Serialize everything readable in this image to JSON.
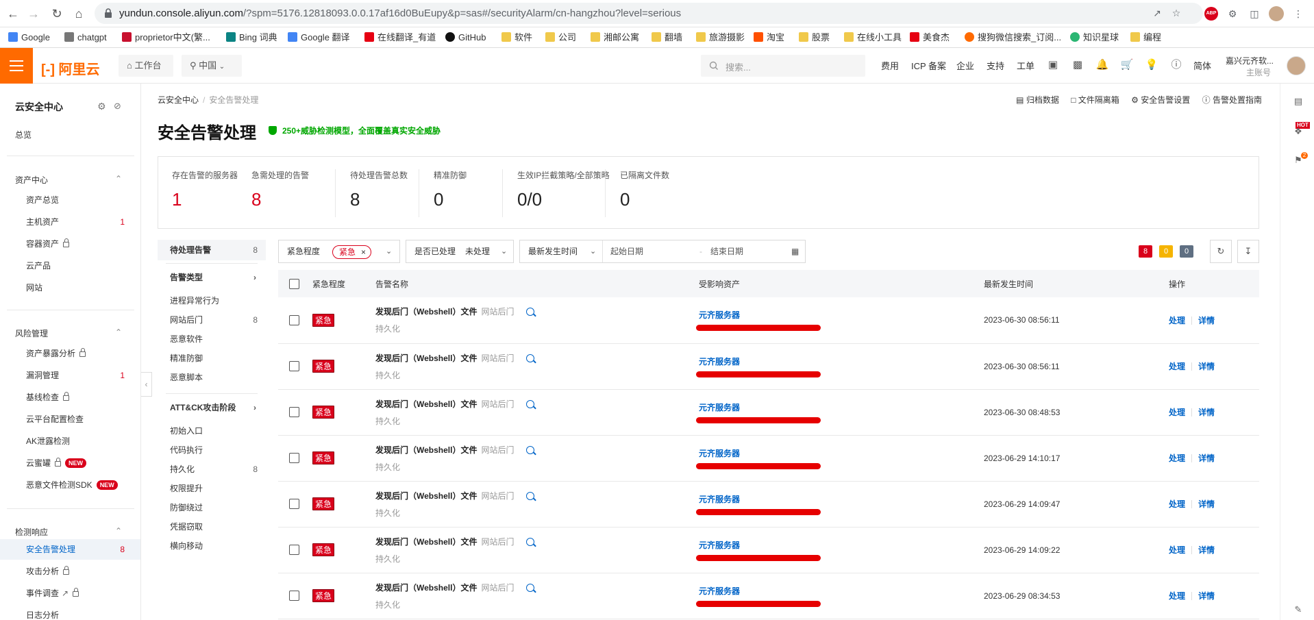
{
  "browser": {
    "url_host": "yundun.console.aliyun.com",
    "url_rest": "/?spm=5176.12818093.0.0.17af16d0BuEupy&p=sas#/securityAlarm/cn-hangzhou?level=serious",
    "bookmarks": [
      "Google",
      "chatgpt",
      "proprietor中文(繁...",
      "Bing 词典",
      "Google 翻译",
      "在线翻译_有道",
      "GitHub",
      "软件",
      "公司",
      "湘邮公寓",
      "翻墙",
      "旅游摄影",
      "淘宝",
      "股票",
      "在线小工具",
      "美食杰",
      "搜狗微信搜索_订阅...",
      "知识星球",
      "编程"
    ],
    "ext_abp": "ABP"
  },
  "header": {
    "logo": "[-] 阿里云",
    "workbench": "工作台",
    "region": "中国",
    "search_placeholder": "搜索...",
    "links": [
      "费用",
      "ICP 备案",
      "企业",
      "支持",
      "工单"
    ],
    "lang": "简体",
    "account_name": "嘉兴元齐软...",
    "account_role": "主账号"
  },
  "sidebar": {
    "title": "云安全中心",
    "overview": "总览",
    "groups": [
      {
        "label": "资产中心",
        "items": [
          {
            "label": "资产总览",
            "count": ""
          },
          {
            "label": "主机资产",
            "count": "1"
          },
          {
            "label": "容器资产",
            "count": "",
            "lock": true
          },
          {
            "label": "云产品",
            "count": ""
          },
          {
            "label": "网站",
            "count": ""
          }
        ]
      },
      {
        "label": "风险管理",
        "items": [
          {
            "label": "资产暴露分析",
            "count": "",
            "lock": true
          },
          {
            "label": "漏洞管理",
            "count": "1"
          },
          {
            "label": "基线检查",
            "count": "",
            "lock": true
          },
          {
            "label": "云平台配置检查",
            "count": ""
          },
          {
            "label": "AK泄露检测",
            "count": ""
          },
          {
            "label": "云蜜罐",
            "count": "",
            "lock": true,
            "new": "NEW"
          },
          {
            "label": "恶意文件检测SDK",
            "count": "",
            "new": "NEW"
          }
        ]
      },
      {
        "label": "检测响应",
        "items": [
          {
            "label": "安全告警处理",
            "count": "8",
            "active": true
          },
          {
            "label": "攻击分析",
            "count": "",
            "lock": true
          },
          {
            "label": "事件调查",
            "count": "",
            "lock": true
          },
          {
            "label": "日志分析",
            "count": ""
          }
        ]
      }
    ]
  },
  "breadcrumb": [
    "云安全中心",
    "安全告警处理"
  ],
  "top_links": [
    "归档数据",
    "文件隔离箱",
    "安全告警设置",
    "告警处置指南"
  ],
  "page_title": "安全告警处理",
  "promo": "250+威胁检测模型，全面覆盖真实安全威胁",
  "stats": [
    {
      "label": "存在告警的服务器",
      "value": "1",
      "red": true
    },
    {
      "label": "急需处理的告警",
      "value": "8",
      "red": true
    },
    {
      "label": "待处理告警总数",
      "value": "8"
    },
    {
      "label": "精准防御",
      "value": "0"
    },
    {
      "label": "生效IP拦截策略/全部策略",
      "value": "0/0"
    },
    {
      "label": "已隔离文件数",
      "value": "0"
    }
  ],
  "categories": {
    "pending": {
      "label": "待处理告警",
      "count": "8"
    },
    "type_head": "告警类型",
    "types": [
      {
        "label": "进程异常行为",
        "count": ""
      },
      {
        "label": "网站后门",
        "count": "8"
      },
      {
        "label": "恶意软件",
        "count": ""
      },
      {
        "label": "精准防御",
        "count": ""
      },
      {
        "label": "恶意脚本",
        "count": ""
      }
    ],
    "attck_head": "ATT&CK攻击阶段",
    "stages": [
      {
        "label": "初始入口",
        "count": ""
      },
      {
        "label": "代码执行",
        "count": ""
      },
      {
        "label": "持久化",
        "count": "8"
      },
      {
        "label": "权限提升",
        "count": ""
      },
      {
        "label": "防御绕过",
        "count": ""
      },
      {
        "label": "凭据窃取",
        "count": ""
      },
      {
        "label": "横向移动",
        "count": ""
      }
    ]
  },
  "filters": {
    "severity_label": "紧急程度",
    "severity_chip": "紧急",
    "handled_label": "是否已处理",
    "handled_value": "未处理",
    "time_label": "最新发生时间",
    "start_placeholder": "起始日期",
    "end_placeholder": "结束日期",
    "badges": [
      {
        "value": "8",
        "color": "#d9001b"
      },
      {
        "value": "0",
        "color": "#f5b400"
      },
      {
        "value": "0",
        "color": "#5f6f82"
      }
    ]
  },
  "table": {
    "columns": [
      "紧急程度",
      "告警名称",
      "受影响资产",
      "最新发生时间",
      "操作"
    ],
    "rows": [
      {
        "severity": "紧急",
        "name": "发现后门（Webshell）文件",
        "type": "网站后门",
        "tag": "持久化",
        "asset": "元齐服务器",
        "time": "2023-06-30 08:56:11"
      },
      {
        "severity": "紧急",
        "name": "发现后门（Webshell）文件",
        "type": "网站后门",
        "tag": "持久化",
        "asset": "元齐服务器",
        "time": "2023-06-30 08:56:11"
      },
      {
        "severity": "紧急",
        "name": "发现后门（Webshell）文件",
        "type": "网站后门",
        "tag": "持久化",
        "asset": "元齐服务器",
        "time": "2023-06-30 08:48:53"
      },
      {
        "severity": "紧急",
        "name": "发现后门（Webshell）文件",
        "type": "网站后门",
        "tag": "持久化",
        "asset": "元齐服务器",
        "time": "2023-06-29 14:10:17"
      },
      {
        "severity": "紧急",
        "name": "发现后门（Webshell）文件",
        "type": "网站后门",
        "tag": "持久化",
        "asset": "元齐服务器",
        "time": "2023-06-29 14:09:47"
      },
      {
        "severity": "紧急",
        "name": "发现后门（Webshell）文件",
        "type": "网站后门",
        "tag": "持久化",
        "asset": "元齐服务器",
        "time": "2023-06-29 14:09:22"
      },
      {
        "severity": "紧急",
        "name": "发现后门（Webshell）文件",
        "type": "网站后门",
        "tag": "持久化",
        "asset": "元齐服务器",
        "time": "2023-06-29 08:34:53"
      }
    ],
    "op_handle": "处理",
    "op_detail": "详情"
  },
  "right_rail": {
    "hot": "HOT",
    "flag_count": "2"
  },
  "colors": {
    "brand": "#ff6a00",
    "link": "#0064c8",
    "danger": "#d9001b",
    "promo": "#00a700"
  }
}
